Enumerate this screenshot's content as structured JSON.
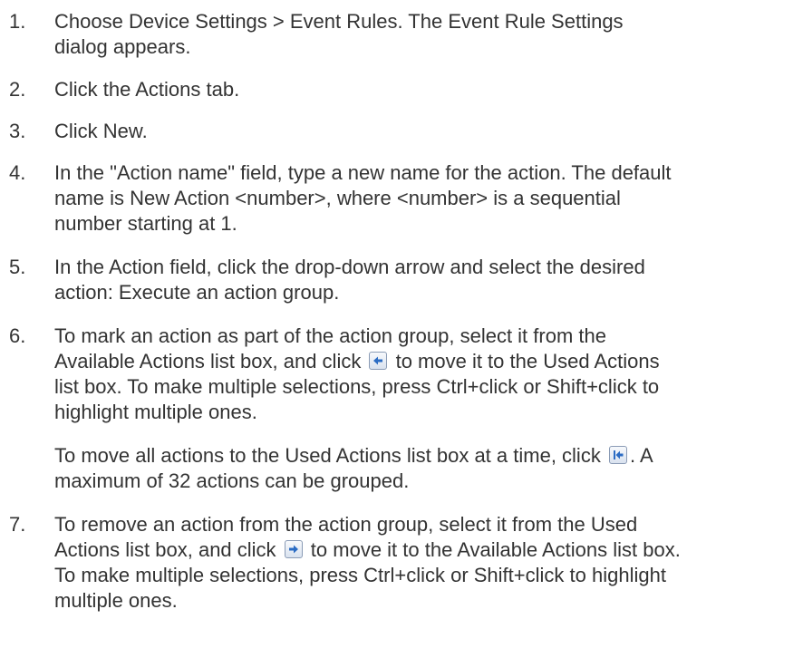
{
  "steps": [
    {
      "num": "1.",
      "lines": [
        "Choose Device Settings > Event Rules. The Event Rule Settings",
        "dialog appears."
      ]
    },
    {
      "num": "2.",
      "lines": [
        "Click the Actions tab."
      ]
    },
    {
      "num": "3.",
      "lines": [
        "Click New."
      ]
    },
    {
      "num": "4.",
      "lines": [
        "In the \"Action name\" field, type a new name for the action. The default",
        "name is New Action <number>, where <number> is a sequential",
        "number starting at 1."
      ]
    },
    {
      "num": "5.",
      "lines": [
        "In the Action field, click the drop-down arrow and select the desired",
        "action: Execute an action group."
      ]
    },
    {
      "num": "6.",
      "lines": [
        "To mark an action as part of the action group, select it from the"
      ],
      "l2a": "Available Actions list box, and click",
      "l2b": "to move it to the Used Actions",
      "rest": [
        "list box. To make multiple selections, press Ctrl+click or Shift+click to",
        "highlight multiple ones."
      ]
    },
    {
      "p_a": "To move all actions to the Used Actions list box at a time, click",
      "p_b": ". A",
      "p_rest": "maximum of 32 actions can be grouped."
    },
    {
      "num": "7.",
      "lines": [
        "To remove an action from the action group, select it from the Used"
      ],
      "l2a": "Actions list box, and click",
      "l2b": "to move it to the Available Actions list box.",
      "rest": [
        "To make multiple selections, press Ctrl+click or Shift+click to highlight",
        "multiple ones."
      ]
    }
  ],
  "icons": {
    "add": "move-left-arrow-icon",
    "add_all": "move-all-left-icon",
    "remove": "move-right-arrow-icon"
  }
}
